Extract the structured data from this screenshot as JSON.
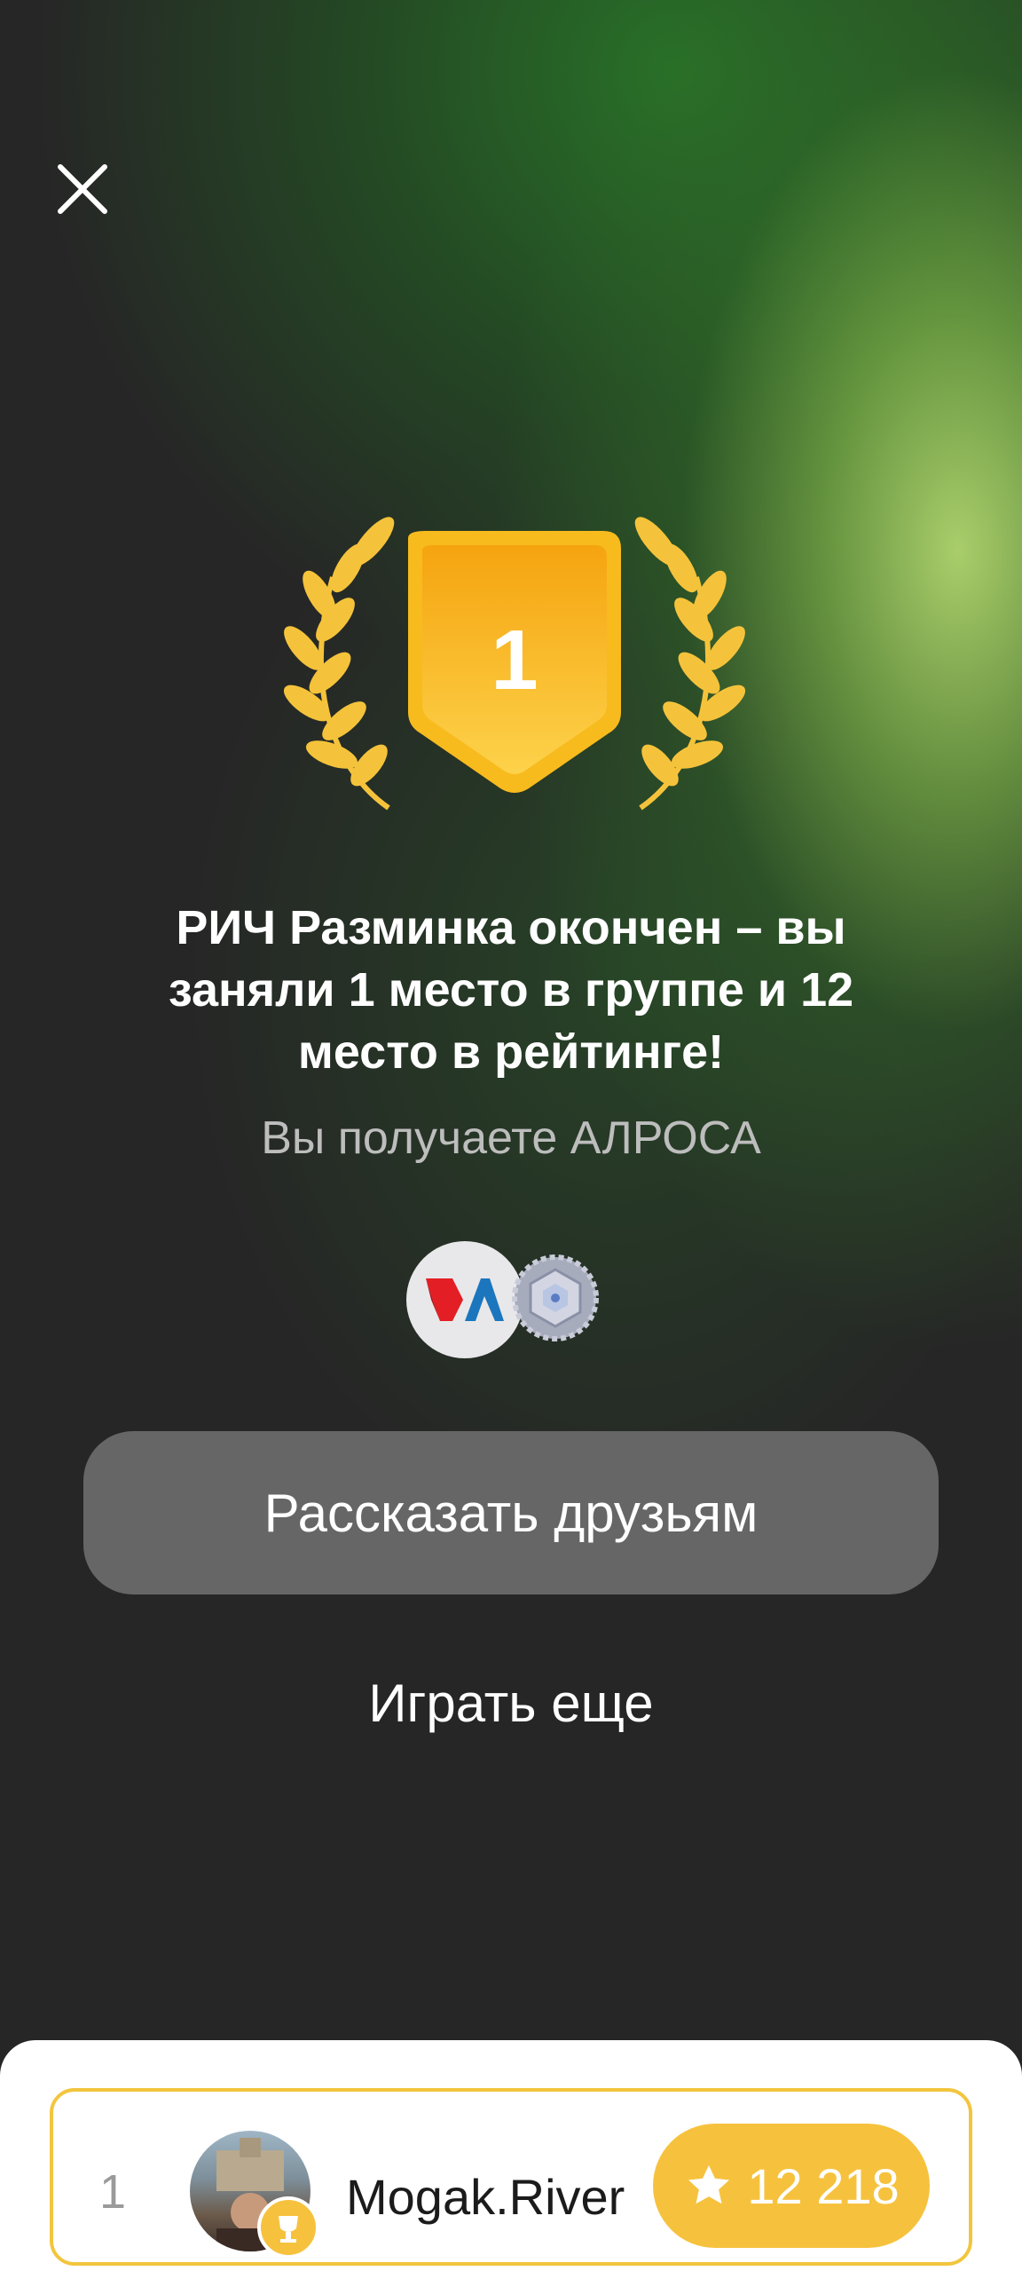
{
  "colors": {
    "background": "#262626",
    "accent_green": "#b0d66e",
    "gold": "#f6c23e",
    "button_gray": "#666666"
  },
  "header": {
    "close_icon": "close-icon"
  },
  "award": {
    "place": "1",
    "icon": "laurel-wreath-icon"
  },
  "result": {
    "title": "РИЧ Разминка окончен – вы заняли 1 место в группе и 12 место в рейтинге!",
    "subtitle": "Вы получаете АЛРОСА"
  },
  "badges": [
    "alrosa-logo-icon",
    "silver-hexagon-badge-icon"
  ],
  "actions": {
    "share_label": "Рассказать друзьям",
    "play_more_label": "Играть еще"
  },
  "leaderboard": {
    "rows": [
      {
        "rank": "1",
        "username": "Mogak.River",
        "score": "12 218"
      }
    ]
  }
}
